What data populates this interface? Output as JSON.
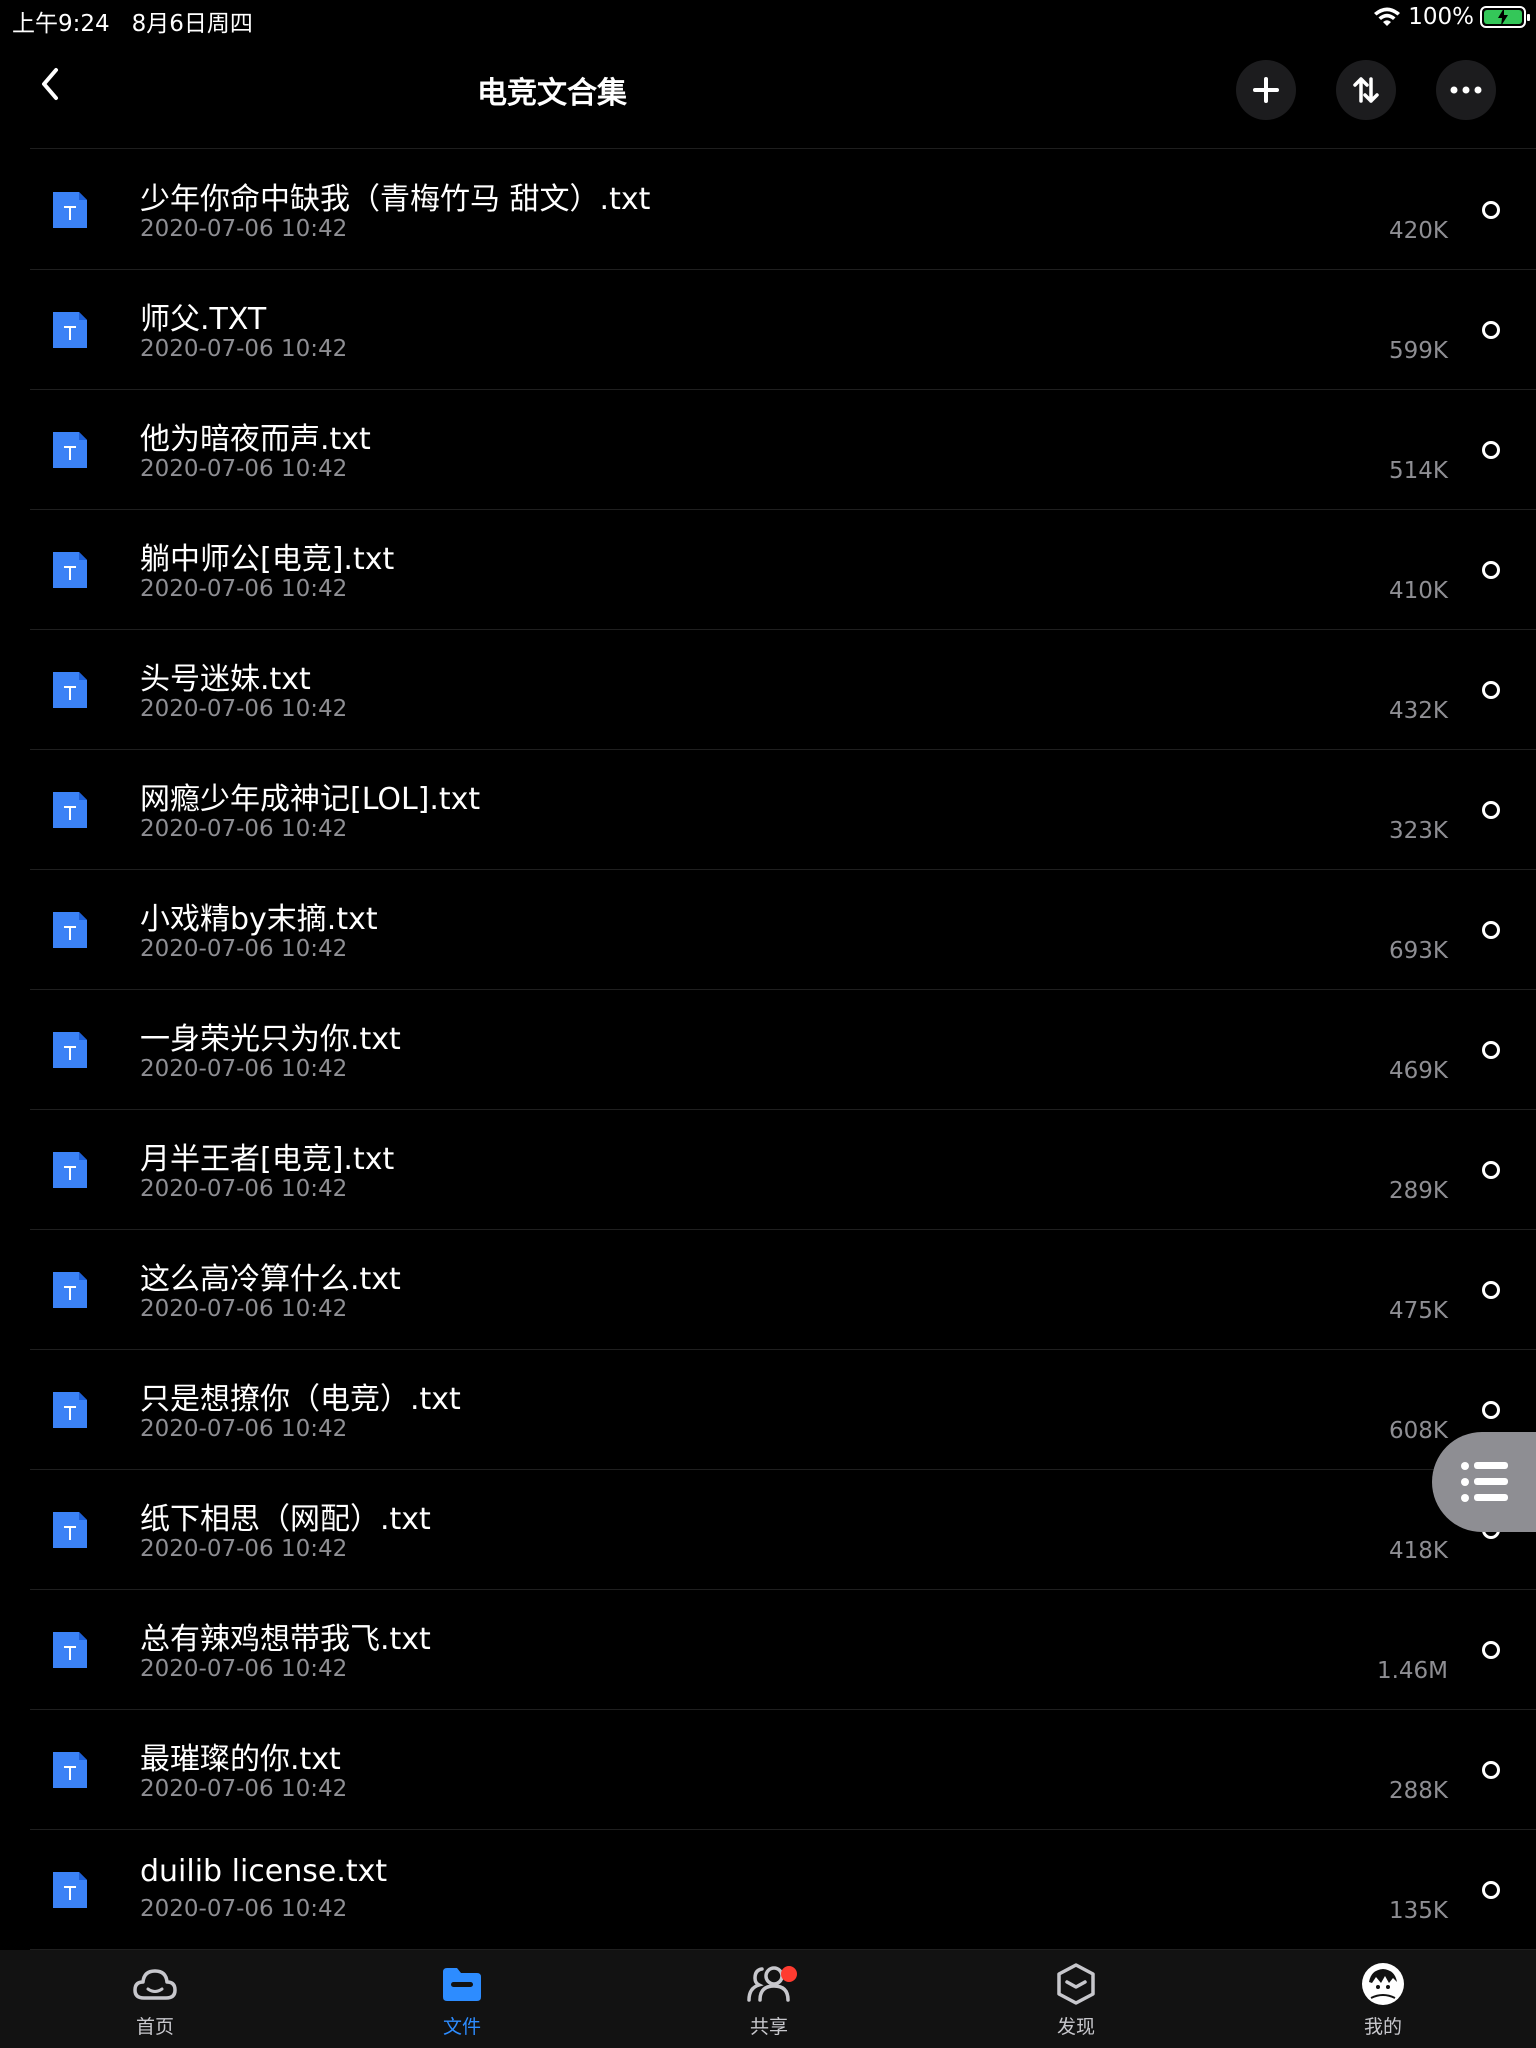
{
  "status_bar": {
    "time": "上午9:24",
    "date": "8月6日周四",
    "battery_percent": "100%"
  },
  "nav": {
    "title": "电竞文合集"
  },
  "files": [
    {
      "name": "少年你命中缺我（青梅竹马 甜文）.txt",
      "date": "2020-07-06 10:42",
      "size": "420K"
    },
    {
      "name": "师父.TXT",
      "date": "2020-07-06 10:42",
      "size": "599K"
    },
    {
      "name": "他为暗夜而声.txt",
      "date": "2020-07-06 10:42",
      "size": "514K"
    },
    {
      "name": "躺中师公[电竞].txt",
      "date": "2020-07-06 10:42",
      "size": "410K"
    },
    {
      "name": "头号迷妹.txt",
      "date": "2020-07-06 10:42",
      "size": "432K"
    },
    {
      "name": "网瘾少年成神记[LOL].txt",
      "date": "2020-07-06 10:42",
      "size": "323K"
    },
    {
      "name": "小戏精by末摘.txt",
      "date": "2020-07-06 10:42",
      "size": "693K"
    },
    {
      "name": "一身荣光只为你.txt",
      "date": "2020-07-06 10:42",
      "size": "469K"
    },
    {
      "name": "月半王者[电竞].txt",
      "date": "2020-07-06 10:42",
      "size": "289K"
    },
    {
      "name": "这么高冷算什么.txt",
      "date": "2020-07-06 10:42",
      "size": "475K"
    },
    {
      "name": "只是想撩你（电竞）.txt",
      "date": "2020-07-06 10:42",
      "size": "608K"
    },
    {
      "name": "纸下相思（网配）.txt",
      "date": "2020-07-06 10:42",
      "size": "418K"
    },
    {
      "name": "总有辣鸡想带我飞.txt",
      "date": "2020-07-06 10:42",
      "size": "1.46M"
    },
    {
      "name": "最璀璨的你.txt",
      "date": "2020-07-06 10:42",
      "size": "288K"
    },
    {
      "name": "duilib license.txt",
      "date": "2020-07-06 10:42",
      "size": "135K"
    }
  ],
  "tabs": [
    {
      "label": "首页",
      "icon": "cloud-icon"
    },
    {
      "label": "文件",
      "icon": "folder-icon",
      "active": true
    },
    {
      "label": "共享",
      "icon": "people-icon"
    },
    {
      "label": "发现",
      "icon": "cube-icon"
    },
    {
      "label": "我的",
      "icon": "avatar"
    }
  ],
  "colors": {
    "background": "#000000",
    "accent": "#2d8cff",
    "file_icon": "#3b82f6",
    "secondary_text": "#8e8e93",
    "notification": "#ff3b30"
  }
}
